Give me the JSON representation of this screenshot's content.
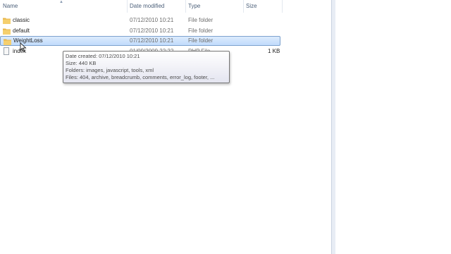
{
  "columns": {
    "name": "Name",
    "date_modified": "Date modified",
    "type": "Type",
    "size": "Size"
  },
  "files": [
    {
      "name": "classic",
      "date": "07/12/2010 10:21",
      "type": "File folder",
      "size": "",
      "icon": "folder-icon"
    },
    {
      "name": "default",
      "date": "07/12/2010 10:21",
      "type": "File folder",
      "size": "",
      "icon": "folder-icon"
    },
    {
      "name": "WeightLoss",
      "date": "07/12/2010 10:21",
      "type": "File folder",
      "size": "",
      "icon": "folder-icon",
      "selected": true
    },
    {
      "name": "index",
      "date": "01/09/2009 22:22",
      "type": "PHP File",
      "size": "1 KB",
      "icon": "file-icon"
    }
  ],
  "tooltip": {
    "created": "Date created: 07/12/2010 10:21",
    "size": "Size: 440 KB",
    "folders": "Folders: images, javascript, tools, xml",
    "files": "Files: 404, archive, breadcrumb, comments, error_log, footer, ..."
  },
  "colors": {
    "folder": "#e8b64a",
    "selection": "#cce4fc",
    "header_text": "#4c607a"
  }
}
